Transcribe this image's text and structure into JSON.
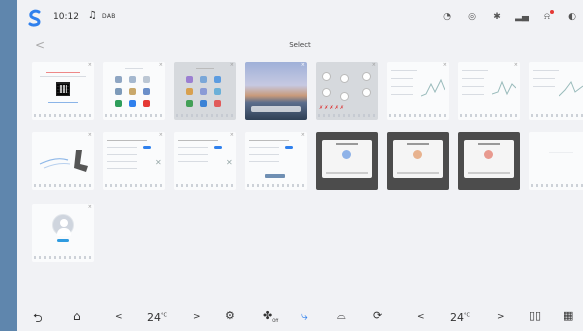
{
  "status": {
    "time": "10:12",
    "source": "DAB",
    "icons": [
      "speed-icon",
      "location-icon",
      "bluetooth-icon",
      "signal-icon",
      "notification-icon",
      "more-icon"
    ]
  },
  "header": {
    "back": "<",
    "title": "Select"
  },
  "bottom": {
    "left_temp": "24",
    "right_temp": "24",
    "temp_unit": "°C",
    "chev_left": "<",
    "chev_right": ">",
    "fan_suffix": "Off",
    "icons": [
      "back-arrow-icon",
      "home-icon",
      "fan-icon",
      "seat-airflow-icon",
      "rear-defrost-icon",
      "recirculation-icon",
      "split-screen-icon",
      "app-grid-icon"
    ]
  },
  "colors": {
    "accent": "#2f80ed",
    "page_bg": "#f1f2f5",
    "sidebar_strip": "#5f86ad"
  }
}
